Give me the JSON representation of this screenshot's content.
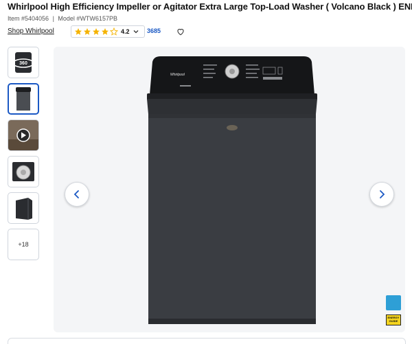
{
  "product": {
    "title": "Whirlpool High Efficiency Impeller or Agitator Extra Large Top-Load Washer ( Volcano Black ) ENERGY",
    "item_number": "Item #5404056",
    "model_number": "Model #WTW6157PB",
    "separator": "|",
    "brand_link": "Shop Whirlpool"
  },
  "rating": {
    "value": "4.2",
    "stars_filled": 4,
    "review_count": "3685",
    "star_color": "#f5b301"
  },
  "gallery": {
    "thumbnails": [
      {
        "kind": "360-view",
        "label": "360"
      },
      {
        "kind": "front-image",
        "label": ""
      },
      {
        "kind": "video",
        "label": ""
      },
      {
        "kind": "open-top-image",
        "label": ""
      },
      {
        "kind": "side-image",
        "label": ""
      }
    ],
    "more_label": "+18",
    "selected_index": 1
  },
  "viewer": {
    "brand_on_washer": "Whirlpool",
    "energy_guide_text": "ENERGY GUIDE"
  },
  "colors": {
    "accent": "#1a58c4",
    "washer_body": "#3a3d42",
    "viewer_bg": "#f4f5f7"
  }
}
